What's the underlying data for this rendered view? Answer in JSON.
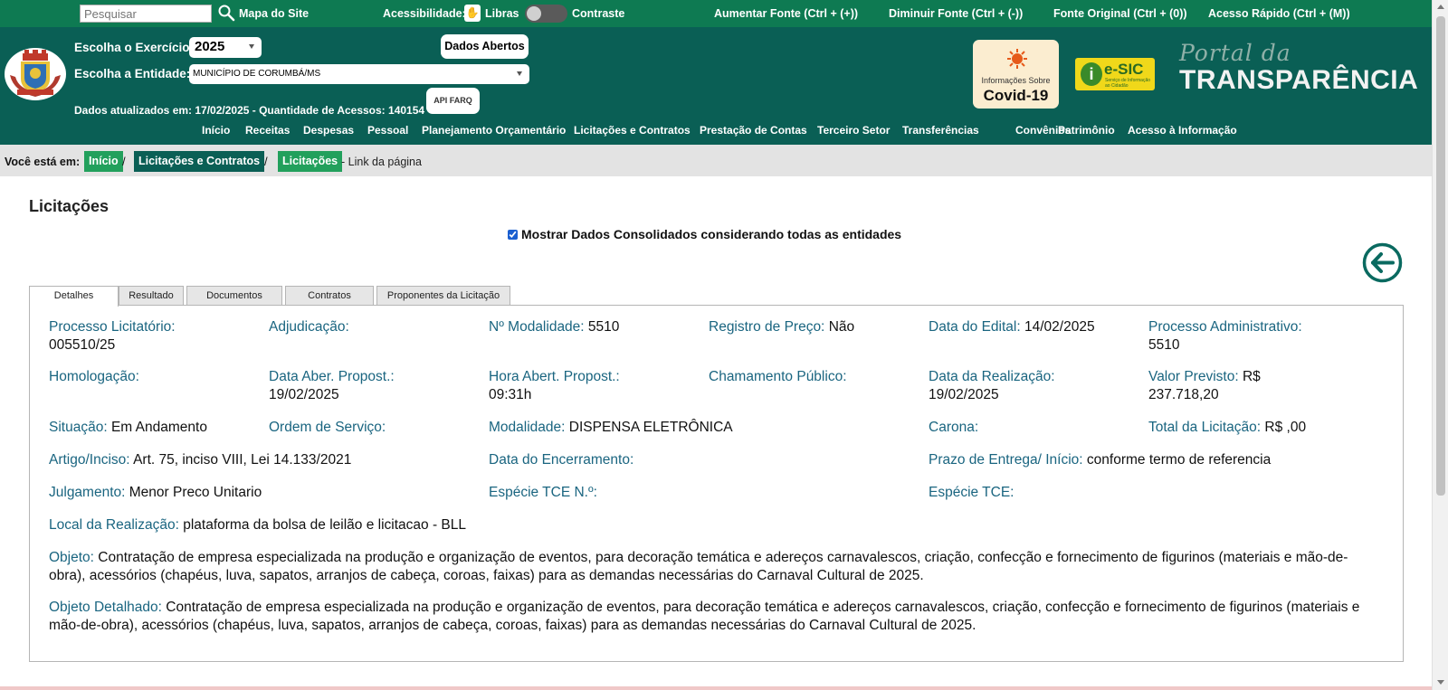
{
  "topbar": {
    "search_placeholder": "Pesquisar",
    "sitemap": "Mapa do Site",
    "accessibility": "Acessibilidade:",
    "libras": "Libras",
    "contrast": "Contraste",
    "font_increase": "Aumentar Fonte (Ctrl + (+))",
    "font_decrease": "Diminuir Fonte (Ctrl + (-))",
    "font_original": "Fonte Original (Ctrl + (0))",
    "quick_access": "Acesso Rápido (Ctrl + (M))"
  },
  "header": {
    "exercise_label": "Escolha o Exercício:",
    "exercise_value": "2025",
    "entity_label": "Escolha a Entidade:",
    "entity_value": "MUNICÍPIO DE CORUMBÁ/MS",
    "open_data": "Dados Abertos",
    "api_label": "API",
    "api_sub": "FARQ",
    "updated": "Dados atualizados em: 17/02/2025 - Quantidade de Acessos: 140154",
    "covid_line1": "Informações Sobre",
    "covid_line2": "Covid-19",
    "esic": "e-SIC",
    "esic_sub": "Serviço de Informação ao Cidadão",
    "portal_line1": "Portal da",
    "portal_line2": "TRANSPARÊNCIA"
  },
  "menu": [
    "Início",
    "Receitas",
    "Despesas",
    "Pessoal",
    "Planejamento Orçamentário",
    "Licitações e Contratos",
    "Prestação de Contas",
    "Terceiro Setor",
    "Transferências",
    "Convênios",
    "Patrimônio",
    "Acesso à Informação"
  ],
  "breadcrumb": {
    "label": "Você está em:",
    "items": [
      "Início",
      "Licitações e Contratos",
      "Licitações"
    ],
    "link": "- Link da página"
  },
  "page": {
    "title": "Licitações",
    "consolidated": "Mostrar Dados Consolidados considerando todas as entidades"
  },
  "tabs": [
    "Detalhes",
    "Resultado",
    "Documentos",
    "Contratos",
    "Proponentes da Licitação"
  ],
  "fields": {
    "processo_licitatorio": {
      "label": "Processo Licitatório:",
      "value": "005510/25"
    },
    "adjudicacao": {
      "label": "Adjudicação:",
      "value": ""
    },
    "n_modalidade": {
      "label": "Nº Modalidade:",
      "value": "5510"
    },
    "registro_preco": {
      "label": "Registro de Preço:",
      "value": "Não"
    },
    "data_edital": {
      "label": "Data do Edital:",
      "value": "14/02/2025"
    },
    "processo_administrativo": {
      "label": "Processo Administrativo:",
      "value": "5510"
    },
    "homologacao": {
      "label": "Homologação:",
      "value": ""
    },
    "data_aber_propost": {
      "label": "Data Aber. Propost.:",
      "value": "19/02/2025"
    },
    "hora_abert_propost": {
      "label": "Hora Abert. Propost.:",
      "value": "09:31h"
    },
    "chamamento_publico": {
      "label": "Chamamento Público:",
      "value": ""
    },
    "data_realizacao": {
      "label": "Data da Realização:",
      "value": "19/02/2025"
    },
    "valor_previsto": {
      "label": "Valor Previsto:",
      "value": "R$ 237.718,20"
    },
    "situacao": {
      "label": "Situação:",
      "value": "Em Andamento"
    },
    "ordem_servico": {
      "label": "Ordem de Serviço:",
      "value": ""
    },
    "modalidade": {
      "label": "Modalidade:",
      "value": "DISPENSA ELETRÔNICA"
    },
    "carona": {
      "label": "Carona:",
      "value": ""
    },
    "total_licitacao": {
      "label": "Total da Licitação:",
      "value": "R$ ,00"
    },
    "artigo_inciso": {
      "label": "Artigo/Inciso:",
      "value": "Art. 75, inciso VIII, Lei 14.133/2021"
    },
    "data_encerramento": {
      "label": "Data do Encerramento:",
      "value": ""
    },
    "prazo_entrega": {
      "label": "Prazo de Entrega/ Início:",
      "value": "conforme termo de referencia"
    },
    "julgamento": {
      "label": "Julgamento:",
      "value": "Menor Preco Unitario"
    },
    "especie_tce_n": {
      "label": "Espécie TCE N.º:",
      "value": ""
    },
    "especie_tce": {
      "label": "Espécie TCE:",
      "value": ""
    },
    "local_realizacao": {
      "label": "Local da Realização:",
      "value": "plataforma da bolsa de leilão e licitacao - BLL"
    },
    "objeto": {
      "label": "Objeto:",
      "value": "Contratação de empresa especializada na produção e organização de eventos, para decoração temática e adereços carnavalescos, criação, confecção e fornecimento de figurinos (materiais e mão-de-obra), acessórios (chapéus, luva, sapatos, arranjos de cabeça, coroas, faixas) para as demandas necessárias do Carnaval Cultural de 2025."
    },
    "objeto_detalhado": {
      "label": "Objeto Detalhado:",
      "value": "Contratação de empresa especializada na produção e organização de eventos, para decoração temática e adereços carnavalescos, criação, confecção e fornecimento de figurinos (materiais e mão-de-obra), acessórios (chapéus, luva, sapatos, arranjos de cabeça, coroas, faixas) para as demandas necessárias do Carnaval Cultural de 2025."
    }
  }
}
